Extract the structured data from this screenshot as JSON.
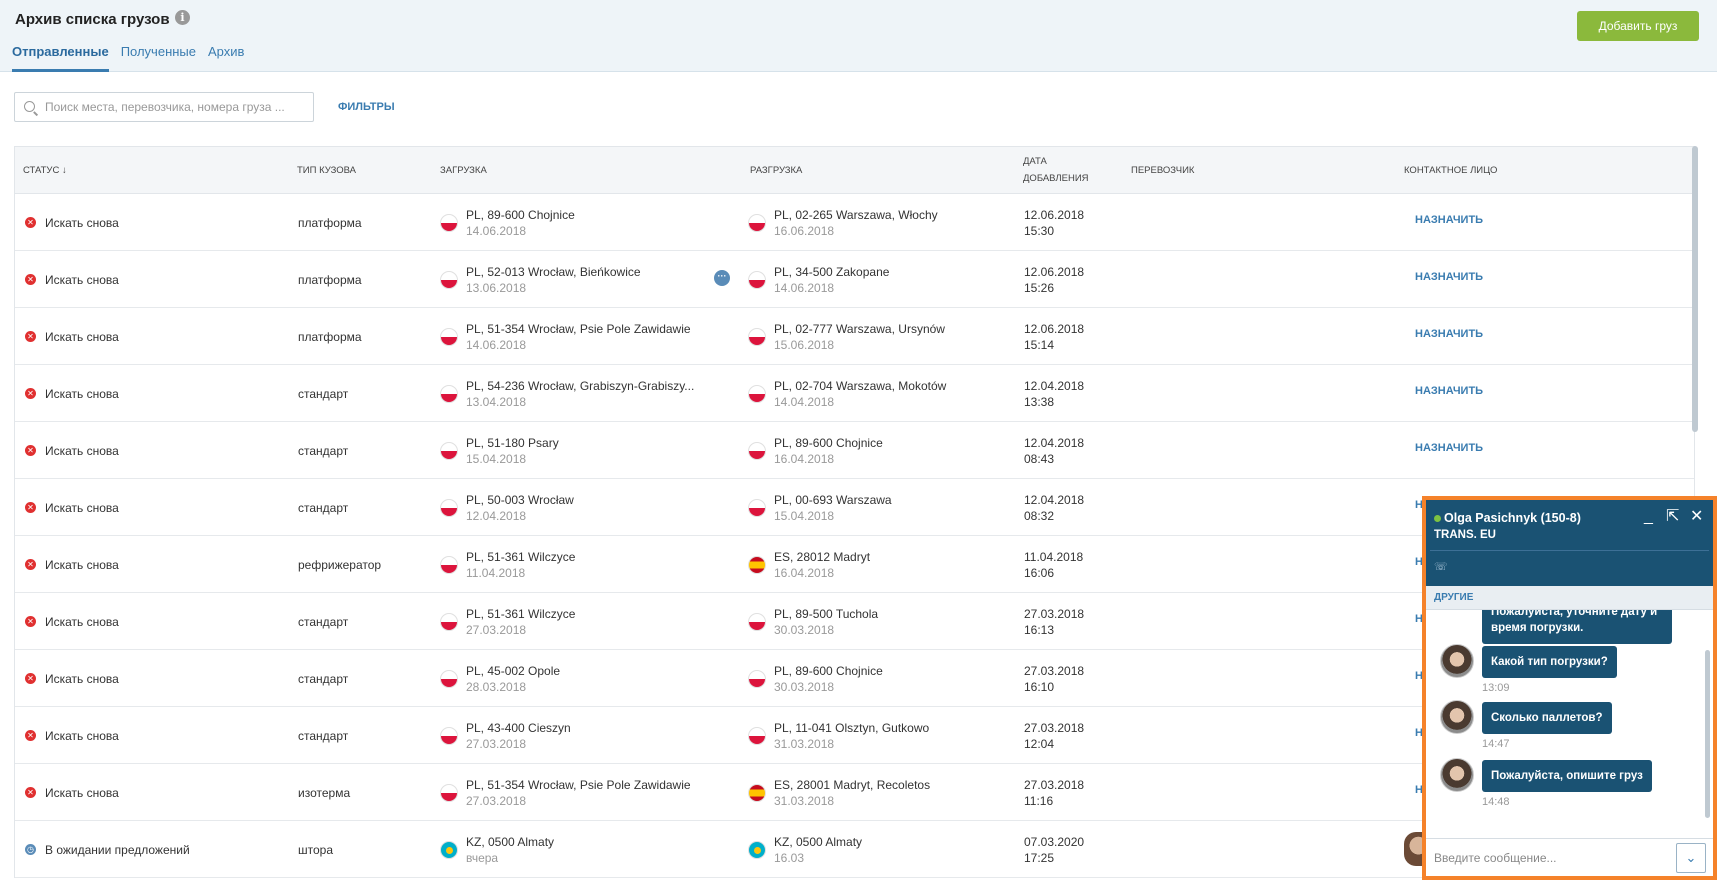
{
  "header": {
    "title": "Архив списка грузов",
    "add_button": "Добавить груз",
    "tabs": [
      {
        "label": "Отправленные",
        "active": true
      },
      {
        "label": "Полученные",
        "active": false
      },
      {
        "label": "Архив",
        "active": false
      }
    ]
  },
  "search": {
    "placeholder": "Поиск места, перевозчика, номера груза ...",
    "filters_label": "ФИЛЬТРЫ"
  },
  "table": {
    "columns": {
      "status": "СТАТУС",
      "body_type": "ТИП КУЗОВА",
      "loading": "ЗАГРУЗКА",
      "unloading": "РАЗГРУЗКА",
      "date_added_1": "ДАТА",
      "date_added_2": "ДОБАВЛЕНИЯ",
      "carrier": "ПЕРЕВОЗЧИК",
      "contact": "КОНТАКТНОЕ ЛИЦО"
    },
    "rows": [
      {
        "status": "Искать снова",
        "body": "платформа",
        "load": "PL, 89-600 Chojnice",
        "load_date": "14.06.2018",
        "load_flag": "pl",
        "unload": "PL, 02-265 Warszawa, Włochy",
        "unload_date": "16.06.2018",
        "unload_flag": "pl",
        "added_date": "12.06.2018",
        "added_time": "15:30",
        "contact": "НАЗНАЧИТЬ"
      },
      {
        "status": "Искать снова",
        "body": "платформа",
        "load": "PL, 52-013 Wrocław, Bieńkowice",
        "load_date": "13.06.2018",
        "load_flag": "pl",
        "unload": "PL, 34-500 Zakopane",
        "unload_date": "14.06.2018",
        "unload_flag": "pl",
        "added_date": "12.06.2018",
        "added_time": "15:26",
        "contact": "НАЗНАЧИТЬ"
      },
      {
        "status": "Искать снова",
        "body": "платформа",
        "load": "PL, 51-354 Wrocław, Psie Pole Zawidawie",
        "load_date": "14.06.2018",
        "load_flag": "pl",
        "unload": "PL, 02-777 Warszawa, Ursynów",
        "unload_date": "15.06.2018",
        "unload_flag": "pl",
        "added_date": "12.06.2018",
        "added_time": "15:14",
        "contact": "НАЗНАЧИТЬ"
      },
      {
        "status": "Искать снова",
        "body": "стандарт",
        "load": "PL, 54-236 Wrocław, Grabiszyn-Grabiszy...",
        "load_date": "13.04.2018",
        "load_flag": "pl",
        "unload": "PL, 02-704 Warszawa, Mokotów",
        "unload_date": "14.04.2018",
        "unload_flag": "pl",
        "added_date": "12.04.2018",
        "added_time": "13:38",
        "contact": "НАЗНАЧИТЬ"
      },
      {
        "status": "Искать снова",
        "body": "стандарт",
        "load": "PL, 51-180 Psary",
        "load_date": "15.04.2018",
        "load_flag": "pl",
        "unload": "PL, 89-600 Chojnice",
        "unload_date": "16.04.2018",
        "unload_flag": "pl",
        "added_date": "12.04.2018",
        "added_time": "08:43",
        "contact": "НАЗНАЧИТЬ"
      },
      {
        "status": "Искать снова",
        "body": "стандарт",
        "load": "PL, 50-003 Wrocław",
        "load_date": "12.04.2018",
        "load_flag": "pl",
        "unload": "PL, 00-693 Warszawa",
        "unload_date": "15.04.2018",
        "unload_flag": "pl",
        "added_date": "12.04.2018",
        "added_time": "08:32",
        "contact": "Н"
      },
      {
        "status": "Искать снова",
        "body": "рефрижератор",
        "load": "PL, 51-361 Wilczyce",
        "load_date": "11.04.2018",
        "load_flag": "pl",
        "unload": "ES, 28012 Madryt",
        "unload_date": "16.04.2018",
        "unload_flag": "es",
        "added_date": "11.04.2018",
        "added_time": "16:06",
        "contact": "Н"
      },
      {
        "status": "Искать снова",
        "body": "стандарт",
        "load": "PL, 51-361 Wilczyce",
        "load_date": "27.03.2018",
        "load_flag": "pl",
        "unload": "PL, 89-500 Tuchola",
        "unload_date": "30.03.2018",
        "unload_flag": "pl",
        "added_date": "27.03.2018",
        "added_time": "16:13",
        "contact": "Н"
      },
      {
        "status": "Искать снова",
        "body": "стандарт",
        "load": "PL, 45-002 Opole",
        "load_date": "28.03.2018",
        "load_flag": "pl",
        "unload": "PL, 89-600 Chojnice",
        "unload_date": "30.03.2018",
        "unload_flag": "pl",
        "added_date": "27.03.2018",
        "added_time": "16:10",
        "contact": "Н"
      },
      {
        "status": "Искать снова",
        "body": "стандарт",
        "load": "PL, 43-400 Cieszyn",
        "load_date": "27.03.2018",
        "load_flag": "pl",
        "unload": "PL, 11-041 Olsztyn, Gutkowo",
        "unload_date": "31.03.2018",
        "unload_flag": "pl",
        "added_date": "27.03.2018",
        "added_time": "12:04",
        "contact": "Н"
      },
      {
        "status": "Искать снова",
        "body": "изотерма",
        "load": "PL, 51-354 Wrocław, Psie Pole Zawidawie",
        "load_date": "27.03.2018",
        "load_flag": "pl",
        "unload": "ES, 28001 Madryt, Recoletos",
        "unload_date": "31.03.2018",
        "unload_flag": "es",
        "added_date": "27.03.2018",
        "added_time": "11:16",
        "contact": "Н"
      },
      {
        "status": "В ожидании предложений",
        "body": "штора",
        "load": "KZ, 0500 Almaty",
        "load_date": "вчера",
        "load_flag": "kz",
        "unload": "KZ, 0500 Almaty",
        "unload_date": "16.03",
        "unload_flag": "kz",
        "added_date": "07.03.2020",
        "added_time": "17:25",
        "contact": ""
      }
    ]
  },
  "chat": {
    "name": "Olga Pasichnyk (150-8)",
    "company": "TRANS. EU",
    "tab_other": "ДРУГИЕ",
    "partial_msg_1": "Пожалуйста, уточните дату и",
    "partial_msg_2": "время погрузки.",
    "messages": [
      {
        "text": "Какой тип погрузки?",
        "time": "13:09"
      },
      {
        "text": "Сколько паллетов?",
        "time": "14:47"
      },
      {
        "text": "Пожалуйста, опишите груз",
        "time": "14:48"
      }
    ],
    "input_placeholder": "Введите сообщение..."
  }
}
